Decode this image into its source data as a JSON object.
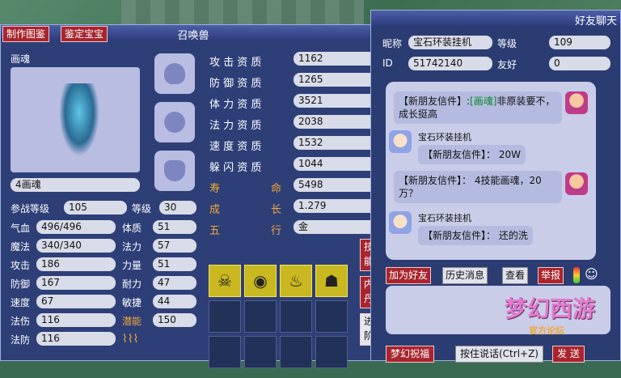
{
  "pet_window": {
    "tab_make": "制作图鉴",
    "tab_appraise": "鉴定宝宝",
    "title": "召唤兽",
    "close": "✕",
    "portrait_label": "画魂",
    "pet_name": "4画魂",
    "level_fight_label": "参战等级",
    "level_fight_value": "105",
    "level_label": "等级",
    "level_value": "30",
    "stats_left": [
      {
        "label": "气血",
        "value": "496/496"
      },
      {
        "label": "魔法",
        "value": "340/340"
      },
      {
        "label": "攻击",
        "value": "186"
      },
      {
        "label": "防御",
        "value": "167"
      },
      {
        "label": "速度",
        "value": "67"
      },
      {
        "label": "法伤",
        "value": "116"
      },
      {
        "label": "法防",
        "value": "116"
      }
    ],
    "stats_mid": [
      {
        "label": "体质",
        "value": "51"
      },
      {
        "label": "法力",
        "value": "57"
      },
      {
        "label": "力量",
        "value": "51"
      },
      {
        "label": "耐力",
        "value": "47"
      },
      {
        "label": "敏捷",
        "value": "44"
      },
      {
        "label": "潜能",
        "value": "150"
      }
    ],
    "aptitudes": [
      {
        "label": "攻 击 资 质",
        "value": "1162"
      },
      {
        "label": "防 御 资 质",
        "value": "1265"
      },
      {
        "label": "体 力 资 质",
        "value": "3521"
      },
      {
        "label": "法 力 资 质",
        "value": "2038"
      },
      {
        "label": "速 度 资 质",
        "value": "1532"
      },
      {
        "label": "躲 闪 资 质",
        "value": "1044"
      }
    ],
    "life_label_a": "寿",
    "life_label_b": "命",
    "life_value": "5498",
    "growth_label_a": "成",
    "growth_label_b": "长",
    "growth_value": "1.279",
    "element_label_a": "五",
    "element_label_b": "行",
    "element_value": "金",
    "side_skill": "技能",
    "side_neidan": "内丹",
    "side_advance": "进阶",
    "skill_icons": [
      "skeleton-icon",
      "eye-swirl-icon",
      "flame-icon",
      "mask-icon"
    ]
  },
  "chat_window": {
    "title": "好友聊天",
    "nick_label": "昵称",
    "nick_value": "宝石环装挂机",
    "grade_label": "等级",
    "grade_value": "109",
    "id_label": "ID",
    "id_value": "51742140",
    "friendly_label": "友好",
    "friendly_value": "0",
    "msg1_prefix": "【新朋友信件】:",
    "msg1_tag": "[画魂]",
    "msg1_text": "非原装要不，成长挺高",
    "sender_name": "宝石环装挂机",
    "msg2_text": "【新朋友信件】： 20W",
    "msg3_text": "【新朋友信件】： 4技能画魂，20万？",
    "msg4_text": "【新朋友信件】： 还的洗",
    "btn_add_friend": "加为好友",
    "btn_history": "历史消息",
    "btn_view": "查看",
    "btn_report": "举报",
    "btn_dream_bless": "梦幻祝福",
    "btn_send_hint": "按住说话(Ctrl+Z)",
    "btn_send": "发 送"
  },
  "logo": {
    "main": "梦幻西游",
    "sub": "官方论坛"
  },
  "colors": {
    "panel": "#2e3f78",
    "accent_red": "#a8252e",
    "gold": "#f0a73a"
  }
}
